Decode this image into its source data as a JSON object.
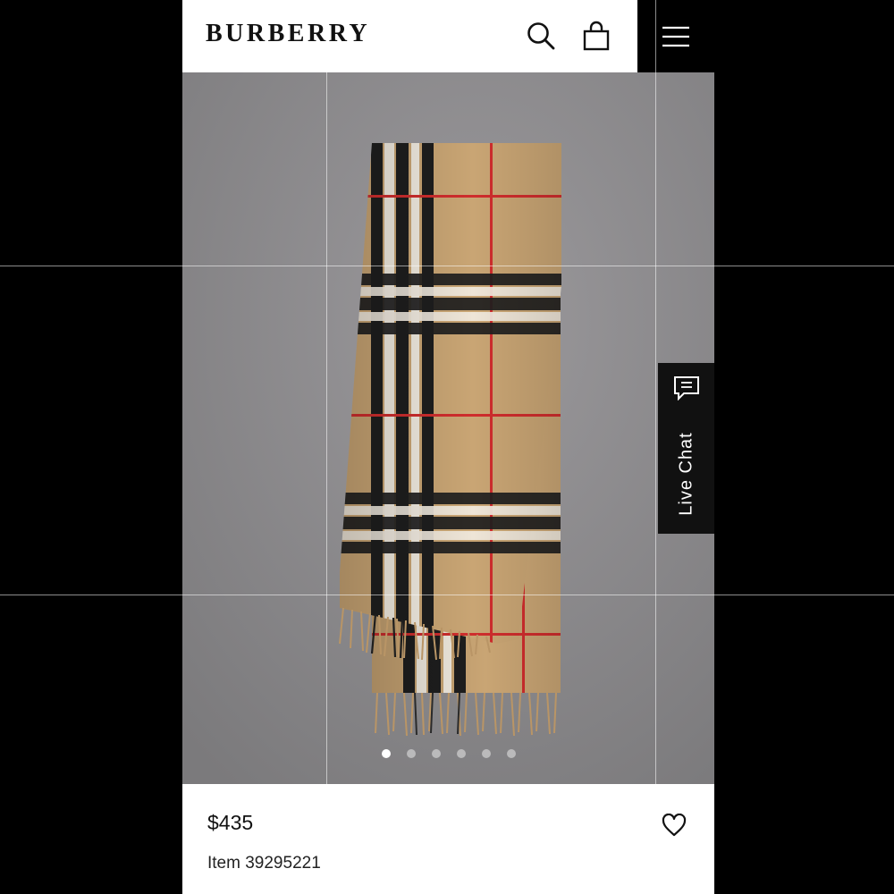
{
  "header": {
    "logo": "BURBERRY",
    "icons": [
      "search-icon",
      "shopping-bag-icon",
      "menu-icon"
    ]
  },
  "gallery": {
    "slide_count": 6,
    "active_slide": 1
  },
  "live_chat": {
    "label": "Live Chat",
    "icon": "chat-icon"
  },
  "product": {
    "price": "$435",
    "item_number": "Item 39295221",
    "wishlist_icon": "heart-icon"
  },
  "colors": {
    "camel": "#c9a574",
    "check_black": "#1e1e1e",
    "check_white": "#f1ebe0",
    "check_red": "#cf2d2d",
    "wall": "#8d8c8e"
  }
}
